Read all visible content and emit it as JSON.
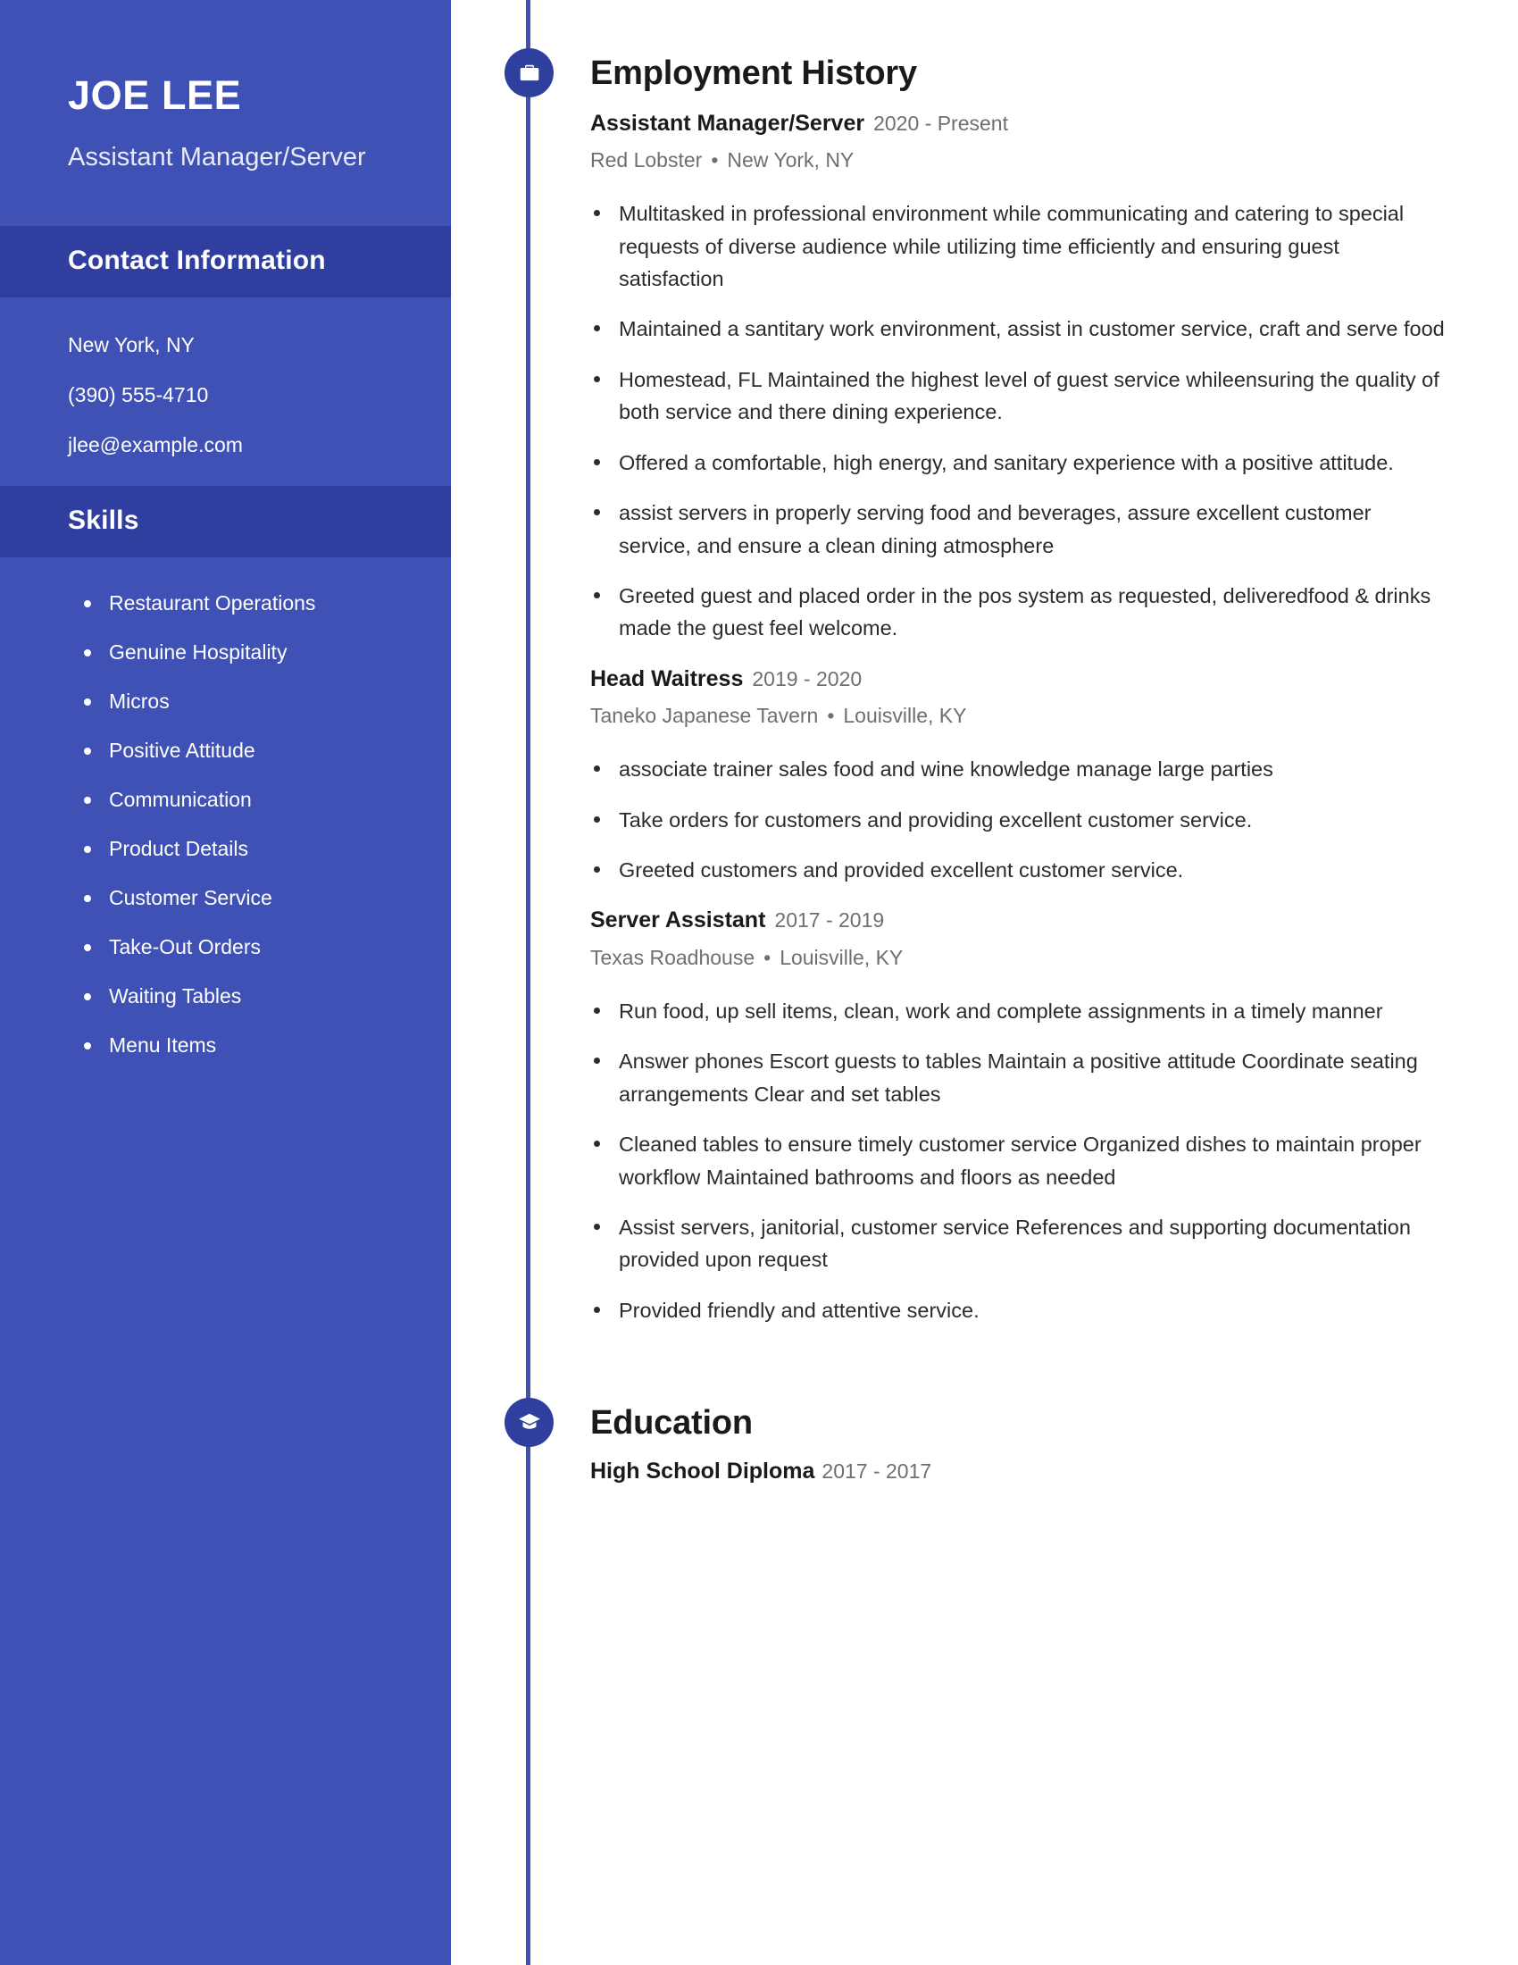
{
  "sidebar": {
    "full_name": "JOE LEE",
    "job_title": "Assistant Manager/Server",
    "contact": {
      "heading": "Contact Information",
      "items": [
        "New York, NY",
        "(390) 555-4710",
        "jlee@example.com"
      ]
    },
    "skills": {
      "heading": "Skills",
      "items": [
        "Restaurant Operations",
        "Genuine Hospitality",
        "Micros",
        "Positive Attitude",
        "Communication",
        "Product Details",
        "Customer Service",
        "Take-Out Orders",
        "Waiting Tables",
        "Menu Items"
      ]
    }
  },
  "main": {
    "employment": {
      "heading": "Employment History",
      "icon": "briefcase-icon",
      "jobs": [
        {
          "role": "Assistant Manager/Server",
          "dates": "2020 - Present",
          "company": "Red Lobster",
          "location": "New York, NY",
          "separator": "•",
          "bullets": [
            "Multitasked in professional environment while communicating and catering to special requests of diverse audience while utilizing time efficiently and ensuring guest satisfaction",
            "Maintained a santitary work environment, assist in customer service, craft and serve food",
            "Homestead, FL Maintained the highest level of guest service whileensuring the quality of both service and there dining experience.",
            "Offered a comfortable, high energy, and sanitary experience with a positive attitude.",
            "assist servers in properly serving food and beverages, assure excellent customer service, and ensure a clean dining atmosphere",
            "Greeted guest and placed order in the pos system as requested, deliveredfood & drinks made the guest feel welcome."
          ]
        },
        {
          "role": "Head Waitress",
          "dates": "2019 - 2020",
          "company": "Taneko Japanese Tavern",
          "location": "Louisville, KY",
          "separator": "•",
          "bullets": [
            "associate trainer sales food and wine knowledge manage large parties",
            "Take orders for customers and providing excellent customer service.",
            "Greeted customers and provided excellent customer service."
          ]
        },
        {
          "role": "Server Assistant",
          "dates": "2017 - 2019",
          "company": "Texas Roadhouse",
          "location": "Louisville, KY",
          "separator": "•",
          "bullets": [
            "Run food, up sell items, clean, work and complete assignments in a timely manner",
            "Answer phones Escort guests to tables Maintain a positive attitude Coordinate seating arrangements Clear and set tables",
            "Cleaned tables to ensure timely customer service Organized dishes to maintain proper workflow Maintained bathrooms and floors as needed",
            "Assist servers, janitorial, customer service References and supporting documentation provided upon request",
            "Provided friendly and attentive service."
          ]
        }
      ]
    },
    "education": {
      "heading": "Education",
      "icon": "graduation-cap-icon",
      "entries": [
        {
          "degree": "High School Diploma",
          "dates": "2017 - 2017"
        }
      ]
    }
  },
  "colors": {
    "sidebar_bg": "#3f51b5",
    "sidebar_band_bg": "#303f9f",
    "accent": "#2f3f9e",
    "text_dark": "#1a1a1a",
    "text_muted": "#6f6f6f"
  }
}
